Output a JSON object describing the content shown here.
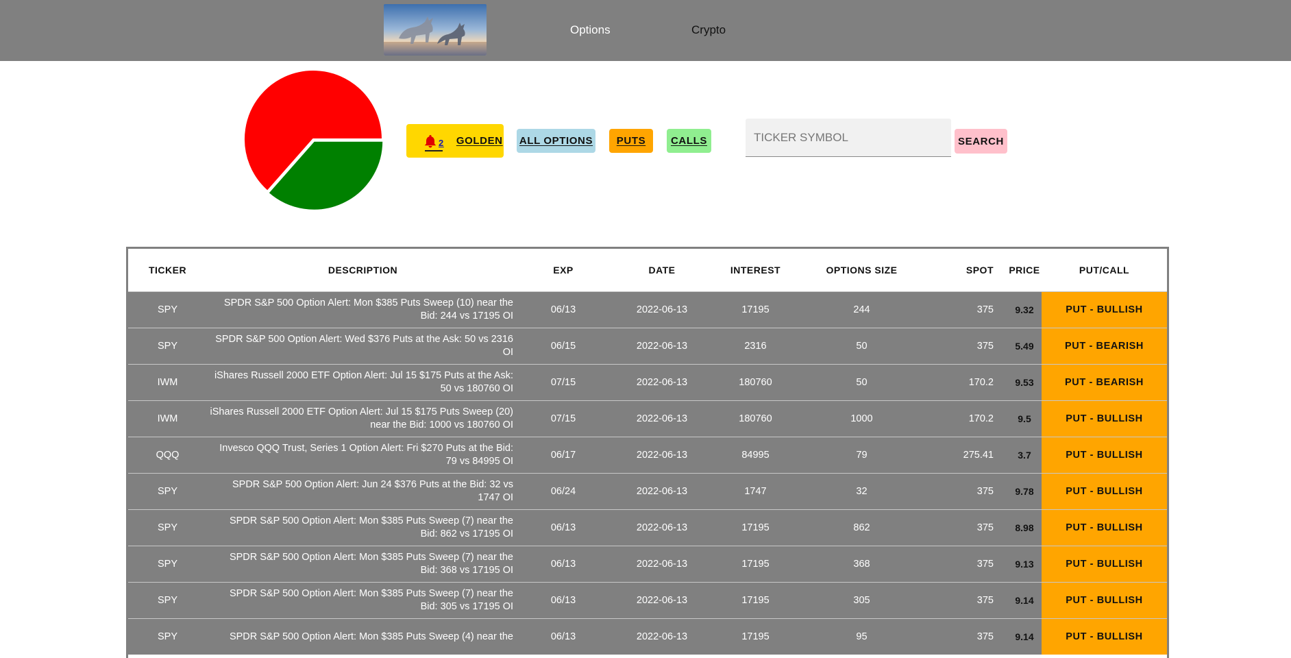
{
  "header": {
    "logo_alt": "bull statues at sunset",
    "nav": [
      {
        "label": "Options"
      },
      {
        "label": "Crypto"
      }
    ]
  },
  "pie": {
    "slices": [
      {
        "color": "#ff0000",
        "fraction": 0.635
      },
      {
        "color": "#008000",
        "fraction": 0.365
      }
    ]
  },
  "filters": {
    "golden_count": "2",
    "golden_label": "GOLDEN",
    "all_label": "ALL OPTIONS",
    "puts_label": "PUTS",
    "calls_label": "CALLS"
  },
  "search": {
    "placeholder": "TICKER SYMBOL",
    "button_label": "SEARCH"
  },
  "table": {
    "columns": [
      "TICKER",
      "DESCRIPTION",
      "EXP",
      "DATE",
      "INTEREST",
      "OPTIONS SIZE",
      "SPOT",
      "PRICE",
      "PUT/CALL"
    ],
    "rows": [
      {
        "ticker": "SPY",
        "desc": "SPDR S&P 500 Option Alert: Mon $385 Puts Sweep (10) near the Bid: 244 vs 17195 OI",
        "exp": "06/13",
        "date": "2022-06-13",
        "interest": "17195",
        "size": "244",
        "spot": "375",
        "price": "9.32",
        "pc": "PUT - BULLISH"
      },
      {
        "ticker": "SPY",
        "desc": "SPDR S&P 500 Option Alert: Wed $376 Puts at the Ask: 50 vs 2316 OI",
        "exp": "06/15",
        "date": "2022-06-13",
        "interest": "2316",
        "size": "50",
        "spot": "375",
        "price": "5.49",
        "pc": "PUT - BEARISH"
      },
      {
        "ticker": "IWM",
        "desc": "iShares Russell 2000 ETF Option Alert: Jul 15 $175 Puts at the Ask: 50 vs 180760 OI",
        "exp": "07/15",
        "date": "2022-06-13",
        "interest": "180760",
        "size": "50",
        "spot": "170.2",
        "price": "9.53",
        "pc": "PUT - BEARISH"
      },
      {
        "ticker": "IWM",
        "desc": "iShares Russell 2000 ETF Option Alert: Jul 15 $175 Puts Sweep (20) near the Bid: 1000 vs 180760 OI",
        "exp": "07/15",
        "date": "2022-06-13",
        "interest": "180760",
        "size": "1000",
        "spot": "170.2",
        "price": "9.5",
        "pc": "PUT - BULLISH"
      },
      {
        "ticker": "QQQ",
        "desc": "Invesco QQQ Trust, Series 1 Option Alert: Fri $270 Puts at the Bid: 79 vs 84995 OI",
        "exp": "06/17",
        "date": "2022-06-13",
        "interest": "84995",
        "size": "79",
        "spot": "275.41",
        "price": "3.7",
        "pc": "PUT - BULLISH"
      },
      {
        "ticker": "SPY",
        "desc": "SPDR S&P 500 Option Alert: Jun 24 $376 Puts at the Bid: 32 vs 1747 OI",
        "exp": "06/24",
        "date": "2022-06-13",
        "interest": "1747",
        "size": "32",
        "spot": "375",
        "price": "9.78",
        "pc": "PUT - BULLISH"
      },
      {
        "ticker": "SPY",
        "desc": "SPDR S&P 500 Option Alert: Mon $385 Puts Sweep (7) near the Bid: 862 vs 17195 OI",
        "exp": "06/13",
        "date": "2022-06-13",
        "interest": "17195",
        "size": "862",
        "spot": "375",
        "price": "8.98",
        "pc": "PUT - BULLISH"
      },
      {
        "ticker": "SPY",
        "desc": "SPDR S&P 500 Option Alert: Mon $385 Puts Sweep (7) near the Bid: 368 vs 17195 OI",
        "exp": "06/13",
        "date": "2022-06-13",
        "interest": "17195",
        "size": "368",
        "spot": "375",
        "price": "9.13",
        "pc": "PUT - BULLISH"
      },
      {
        "ticker": "SPY",
        "desc": "SPDR S&P 500 Option Alert: Mon $385 Puts Sweep (7) near the Bid: 305 vs 17195 OI",
        "exp": "06/13",
        "date": "2022-06-13",
        "interest": "17195",
        "size": "305",
        "spot": "375",
        "price": "9.14",
        "pc": "PUT - BULLISH"
      },
      {
        "ticker": "SPY",
        "desc": "SPDR S&P 500 Option Alert: Mon $385 Puts Sweep (4) near the",
        "exp": "06/13",
        "date": "2022-06-13",
        "interest": "17195",
        "size": "95",
        "spot": "375",
        "price": "9.14",
        "pc": "PUT - BULLISH"
      }
    ]
  }
}
